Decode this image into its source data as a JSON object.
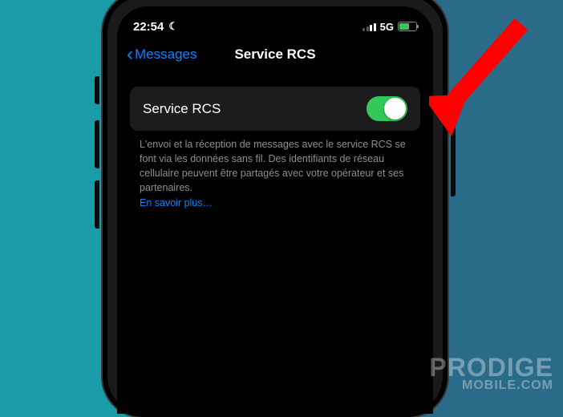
{
  "status_bar": {
    "time": "22:54",
    "network_label": "5G"
  },
  "nav": {
    "back_label": "Messages",
    "title": "Service RCS"
  },
  "setting": {
    "label": "Service RCS",
    "toggle_on": true
  },
  "footer": {
    "description": "L'envoi et la réception de messages avec le service RCS se font via les données sans fil. Des identifiants de réseau cellulaire peuvent être partagés avec votre opérateur et ses partenaires.",
    "learn_more": "En savoir plus…"
  },
  "watermark": {
    "line1": "PRODIGE",
    "line2": "MOBILE.COM"
  }
}
